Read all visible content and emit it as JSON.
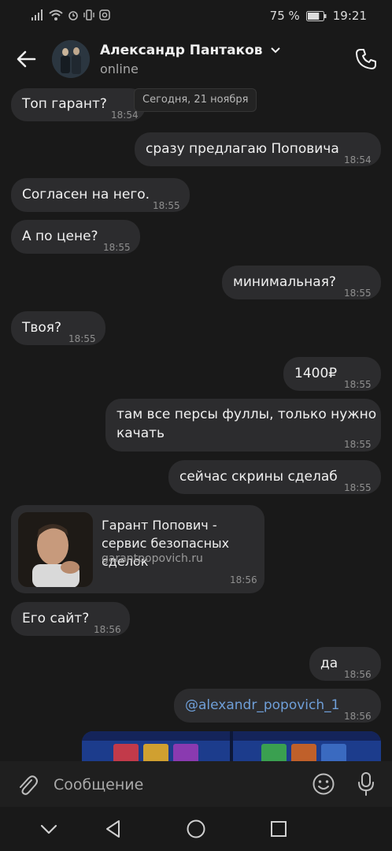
{
  "status_bar": {
    "battery_percent": "75 %",
    "time": "19:21",
    "battery_level": 0.75
  },
  "header": {
    "contact_name": "Александр Пантаков",
    "status": "online"
  },
  "date_chip": "Сегодня, 21 ноября",
  "messages": [
    {
      "dir": "in",
      "text": "Топ гарант?",
      "time": "18:54"
    },
    {
      "dir": "out",
      "text": "сразу предлагаю Поповича",
      "time": "18:54"
    },
    {
      "dir": "in",
      "text": "Согласен на него.",
      "time": "18:55"
    },
    {
      "dir": "in",
      "text": "А по цене?",
      "time": "18:55"
    },
    {
      "dir": "out",
      "text": "минимальная?",
      "time": "18:55"
    },
    {
      "dir": "in",
      "text": "Твоя?",
      "time": "18:55"
    },
    {
      "dir": "out",
      "text": "1400₽",
      "time": "18:55"
    },
    {
      "dir": "out",
      "text": "там все персы фуллы, только нужно качать",
      "time": "18:55"
    },
    {
      "dir": "out",
      "text": "сейчас скрины сделаб",
      "time": "18:55"
    },
    {
      "dir": "in",
      "type": "link",
      "title": "Гарант Попович - сервис безопасных сделок",
      "domain": "garantpopovich.ru",
      "time": "18:56"
    },
    {
      "dir": "in",
      "text": "Его сайт?",
      "time": "18:56"
    },
    {
      "dir": "out",
      "text": "да",
      "time": "18:56"
    },
    {
      "dir": "out",
      "text": "@alexandr_popovich_1",
      "time": "18:56"
    }
  ],
  "composer": {
    "placeholder": "Сообщение"
  },
  "colors": {
    "background": "#191919",
    "bubble": "#2c2c2e",
    "mention": "#6f9fd8",
    "time": "#8f8f8f"
  }
}
